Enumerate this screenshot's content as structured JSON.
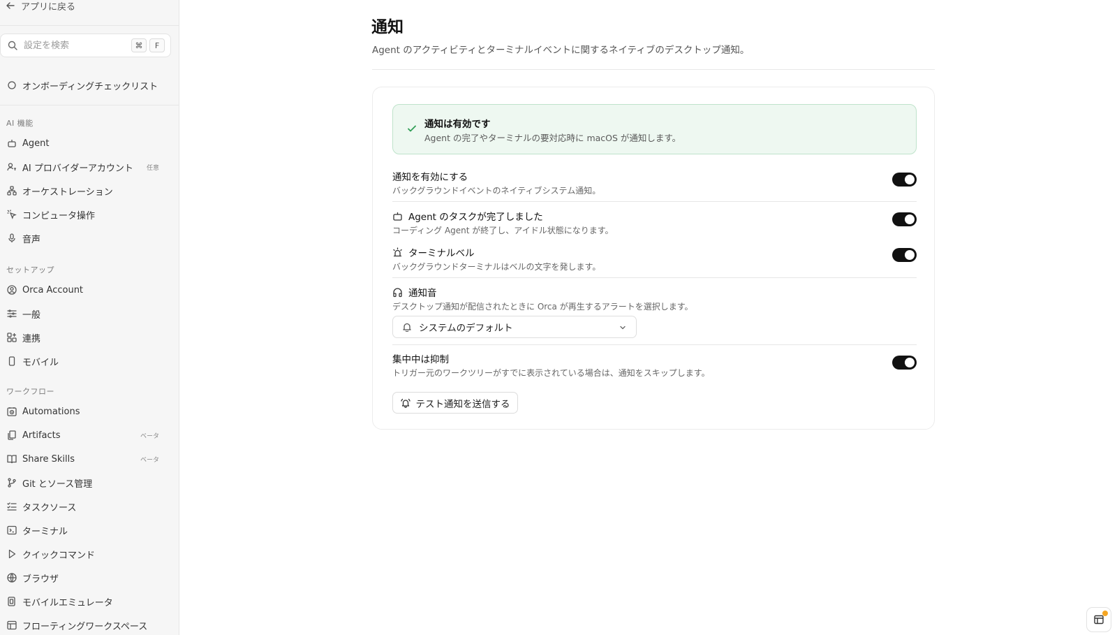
{
  "sidebar": {
    "back_label": "アプリに戻る",
    "search": {
      "placeholder": "設定を検索",
      "shortcut_mod": "⌘",
      "shortcut_key": "F"
    },
    "onboarding": "オンボーディングチェックリスト",
    "sections": {
      "ai": "AI 機能",
      "setup": "セットアップ",
      "workflow": "ワークフロー"
    },
    "items": {
      "agent": "Agent",
      "ai_provider": "AI プロバイダーアカウント",
      "ai_provider_badge": "任意",
      "orchestration": "オーケストレーション",
      "computer_use": "コンピュータ操作",
      "voice": "音声",
      "orca_account": "Orca Account",
      "general": "一般",
      "integrations": "連携",
      "mobile": "モバイル",
      "automations": "Automations",
      "artifacts": "Artifacts",
      "artifacts_badge": "ベータ",
      "share_skills": "Share Skills",
      "share_skills_badge": "ベータ",
      "git": "Git とソース管理",
      "task_sources": "タスクソース",
      "terminal": "ターミナル",
      "quick_commands": "クイックコマンド",
      "browser": "ブラウザ",
      "mobile_emulator": "モバイルエミュレータ",
      "floating_workspace": "フローティングワークスペース"
    }
  },
  "main": {
    "title": "通知",
    "description": "Agent のアクティビティとターミナルイベントに関するネイティブのデスクトップ通知。",
    "banner": {
      "title": "通知は有効です",
      "description": "Agent の完了やターミナルの要対応時に macOS が通知します。"
    },
    "settings": {
      "enable": {
        "title": "通知を有効にする",
        "description": "バックグラウンドイベントのネイティブシステム通知。",
        "on": true
      },
      "agent_done": {
        "title": "Agent のタスクが完了しました",
        "description": "コーディング Agent が終了し、アイドル状態になります。",
        "on": true
      },
      "terminal_bell": {
        "title": "ターミナルベル",
        "description": "バックグラウンドターミナルはベルの文字を発します。",
        "on": true
      },
      "sound": {
        "title": "通知音",
        "description": "デスクトップ通知が配信されたときに Orca が再生するアラートを選択します。",
        "selected": "システムのデフォルト"
      },
      "suppress_focus": {
        "title": "集中中は抑制",
        "description": "トリガー元のワークツリーがすでに表示されている場合は、通知をスキップします。",
        "on": true
      }
    },
    "test_button": "テスト通知を送信する"
  },
  "colors": {
    "accent_toggle": "#111111",
    "success_bg": "#eef8f1",
    "success_border": "#bfe3cb",
    "success_icon": "#2f9e56",
    "dot": "#f5a623"
  },
  "icons": [
    "arrow-left-icon",
    "search-icon",
    "circle-icon",
    "robot-icon",
    "user-key-icon",
    "workflow-icon",
    "pointer-icon",
    "mic-icon",
    "user-circle-icon",
    "sliders-icon",
    "puzzle-icon",
    "phone-icon",
    "clock-icon",
    "files-icon",
    "book-icon",
    "git-branch-icon",
    "list-check-icon",
    "terminal-icon",
    "play-icon",
    "globe-icon",
    "device-icon",
    "window-icon",
    "check-icon",
    "siren-icon",
    "headphones-icon",
    "bell-icon",
    "chevron-down-icon",
    "bell-ring-icon",
    "panel-icon"
  ]
}
